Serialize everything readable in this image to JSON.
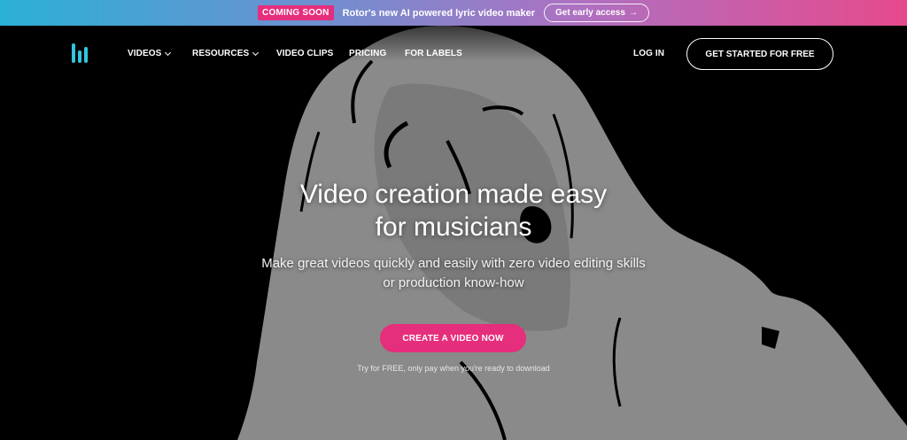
{
  "announcement": {
    "badge": "COMING SOON",
    "message": "Rotor's new AI powered lyric video maker",
    "link_label": "Get early access",
    "link_icon": "arrow-right-icon"
  },
  "nav": {
    "logo": "rotor-logo",
    "items": [
      {
        "label": "VIDEOS",
        "dropdown": true
      },
      {
        "label": "RESOURCES",
        "dropdown": true
      },
      {
        "label": "VIDEO CLIPS",
        "dropdown": false
      },
      {
        "label": "PRICING",
        "dropdown": false
      },
      {
        "label": "FOR LABELS",
        "dropdown": false
      }
    ],
    "login": "LOG IN",
    "get_started": "GET STARTED FOR FREE"
  },
  "hero": {
    "headline_line1": "Video creation made easy",
    "headline_line2": "for musicians",
    "subhead_line1": "Make great videos quickly and easily with zero video editing skills",
    "subhead_line2": "or production know-how",
    "cta": "CREATE A VIDEO NOW",
    "note": "Try for FREE, only pay when you're ready to download"
  },
  "colors": {
    "accent": "#e52e7c",
    "logo": "#2fc6e0",
    "background": "#000000",
    "illustration": "#8c8c8c"
  }
}
